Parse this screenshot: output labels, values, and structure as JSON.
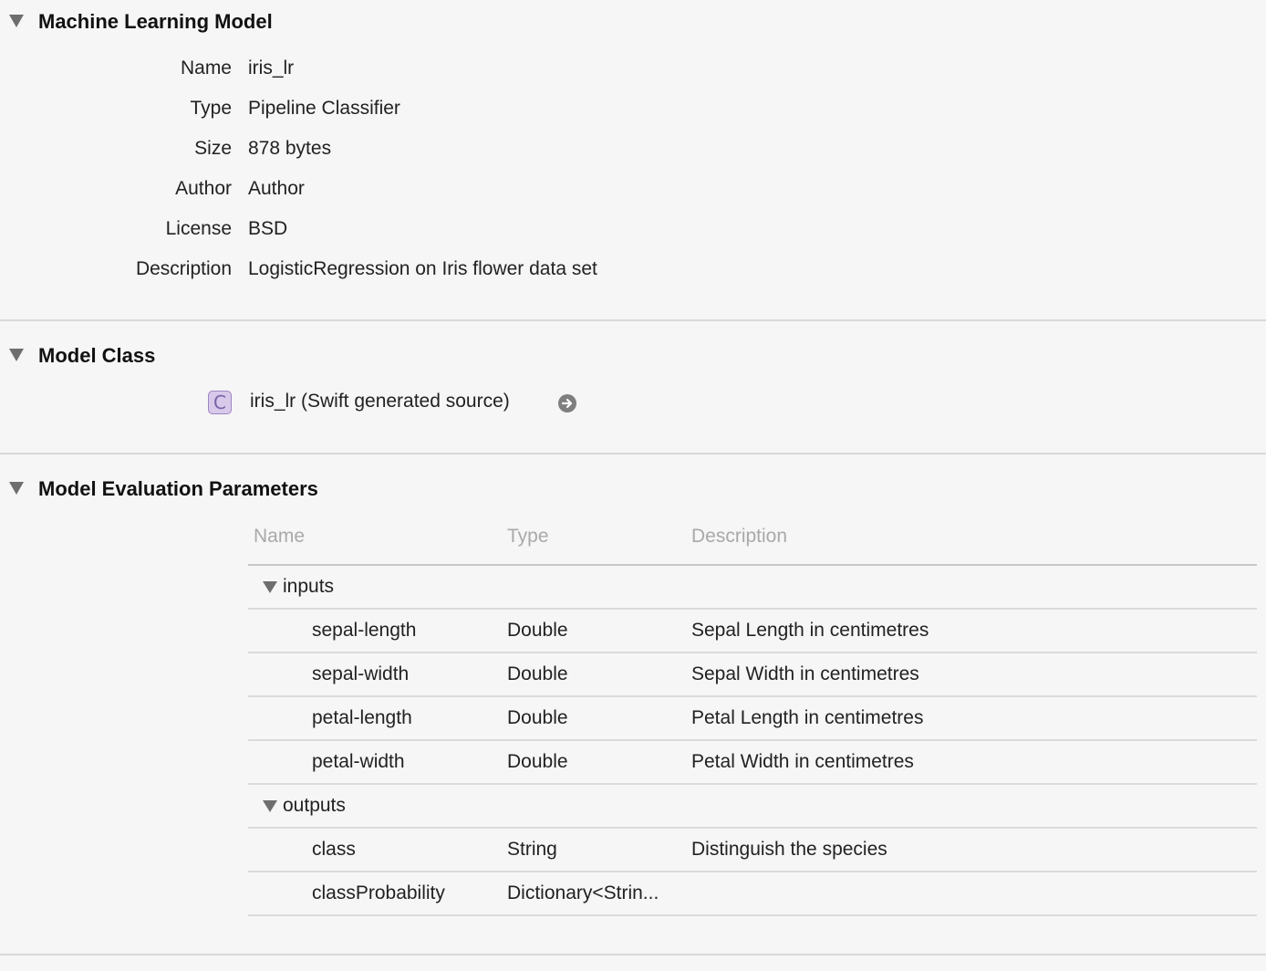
{
  "sections": {
    "ml_model": {
      "title": "Machine Learning Model",
      "fields": [
        {
          "label": "Name",
          "value": "iris_lr"
        },
        {
          "label": "Type",
          "value": "Pipeline Classifier"
        },
        {
          "label": "Size",
          "value": "878 bytes"
        },
        {
          "label": "Author",
          "value": "Author"
        },
        {
          "label": "License",
          "value": "BSD"
        },
        {
          "label": "Description",
          "value": "LogisticRegression on Iris flower data set"
        }
      ]
    },
    "model_class": {
      "title": "Model Class",
      "badge": "C",
      "link_label": "iris_lr (Swift generated source)",
      "icon": "arrow-right-circle-icon"
    },
    "eval_params": {
      "title": "Model Evaluation Parameters",
      "columns": [
        "Name",
        "Type",
        "Description"
      ],
      "groups": [
        {
          "name": "inputs",
          "rows": [
            {
              "name": "sepal-length",
              "type": "Double",
              "description": "Sepal Length in centimetres"
            },
            {
              "name": "sepal-width",
              "type": "Double",
              "description": "Sepal Width in centimetres"
            },
            {
              "name": "petal-length",
              "type": "Double",
              "description": "Petal Length in centimetres"
            },
            {
              "name": "petal-width",
              "type": "Double",
              "description": "Petal Width in centimetres"
            }
          ]
        },
        {
          "name": "outputs",
          "rows": [
            {
              "name": "class",
              "type": "String",
              "description": "Distinguish the species"
            },
            {
              "name": "classProbability",
              "type": "Dictionary<Strin...",
              "description": ""
            }
          ]
        }
      ]
    }
  },
  "colors": {
    "background": "#f6f6f6",
    "badge_fill": "#d8c9ea",
    "badge_text": "#7a60a6",
    "header_text": "#a9a9a9"
  }
}
